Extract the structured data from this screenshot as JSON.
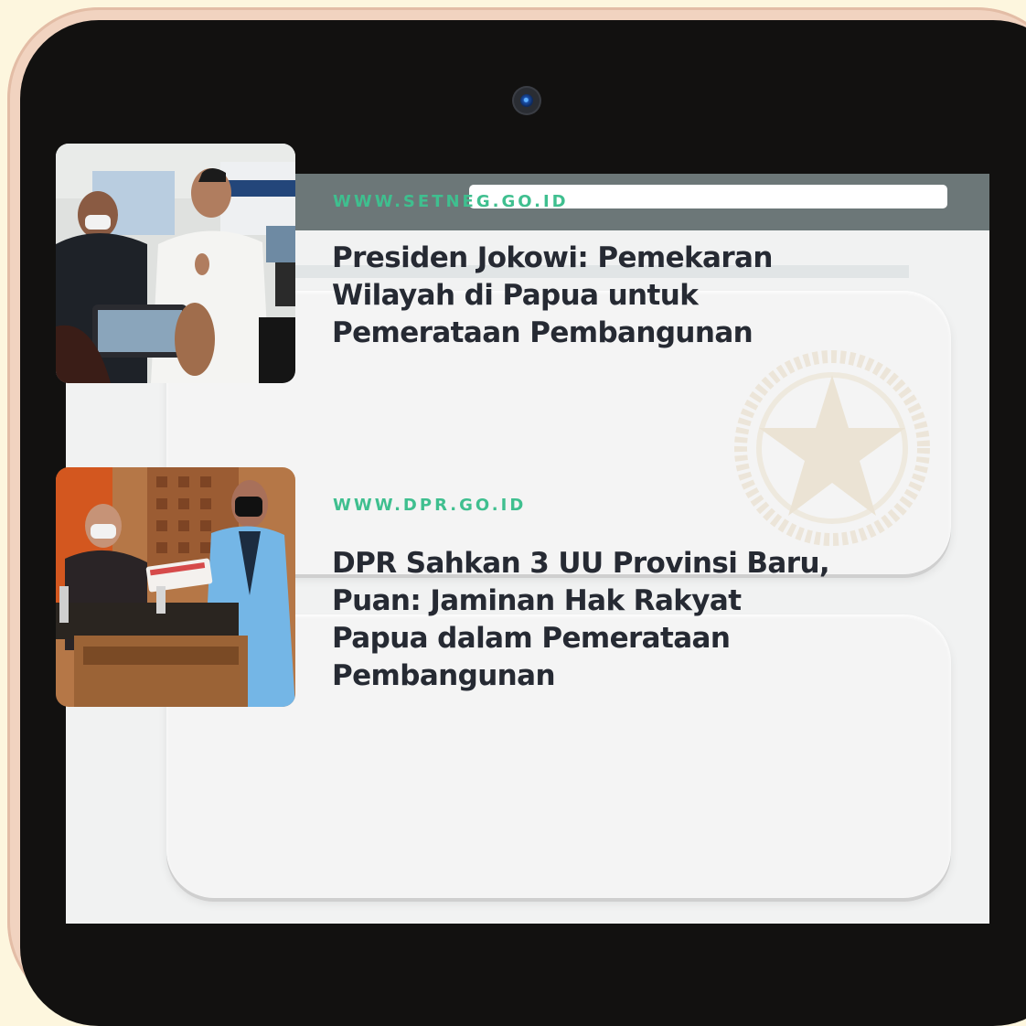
{
  "browser": {
    "address_value": "",
    "window_controls": [
      "green",
      "yellow",
      "red"
    ]
  },
  "articles": [
    {
      "source": "WWW.SETNEG.GO.ID",
      "headline": "Presiden Jokowi: Pemekaran Wilayah di Papua untuk Pemerataan Pembangunan",
      "thumbnail": "photo-president-press-interview"
    },
    {
      "source": "WWW.DPR.GO.ID",
      "headline": "DPR Sahkan 3 UU Provinsi Baru, Puan: Jaminan Hak Rakyat Papua dalam Pemerataan Pembangunan",
      "thumbnail": "photo-dpr-plenary-handover"
    }
  ],
  "colors": {
    "background": "#fdf6de",
    "tablet_bezel": "#121110",
    "tablet_edge": "#f1d3c0",
    "browser_bar": "#6c7778",
    "source_accent": "#3fbf8f",
    "headline_text": "#262a33"
  }
}
